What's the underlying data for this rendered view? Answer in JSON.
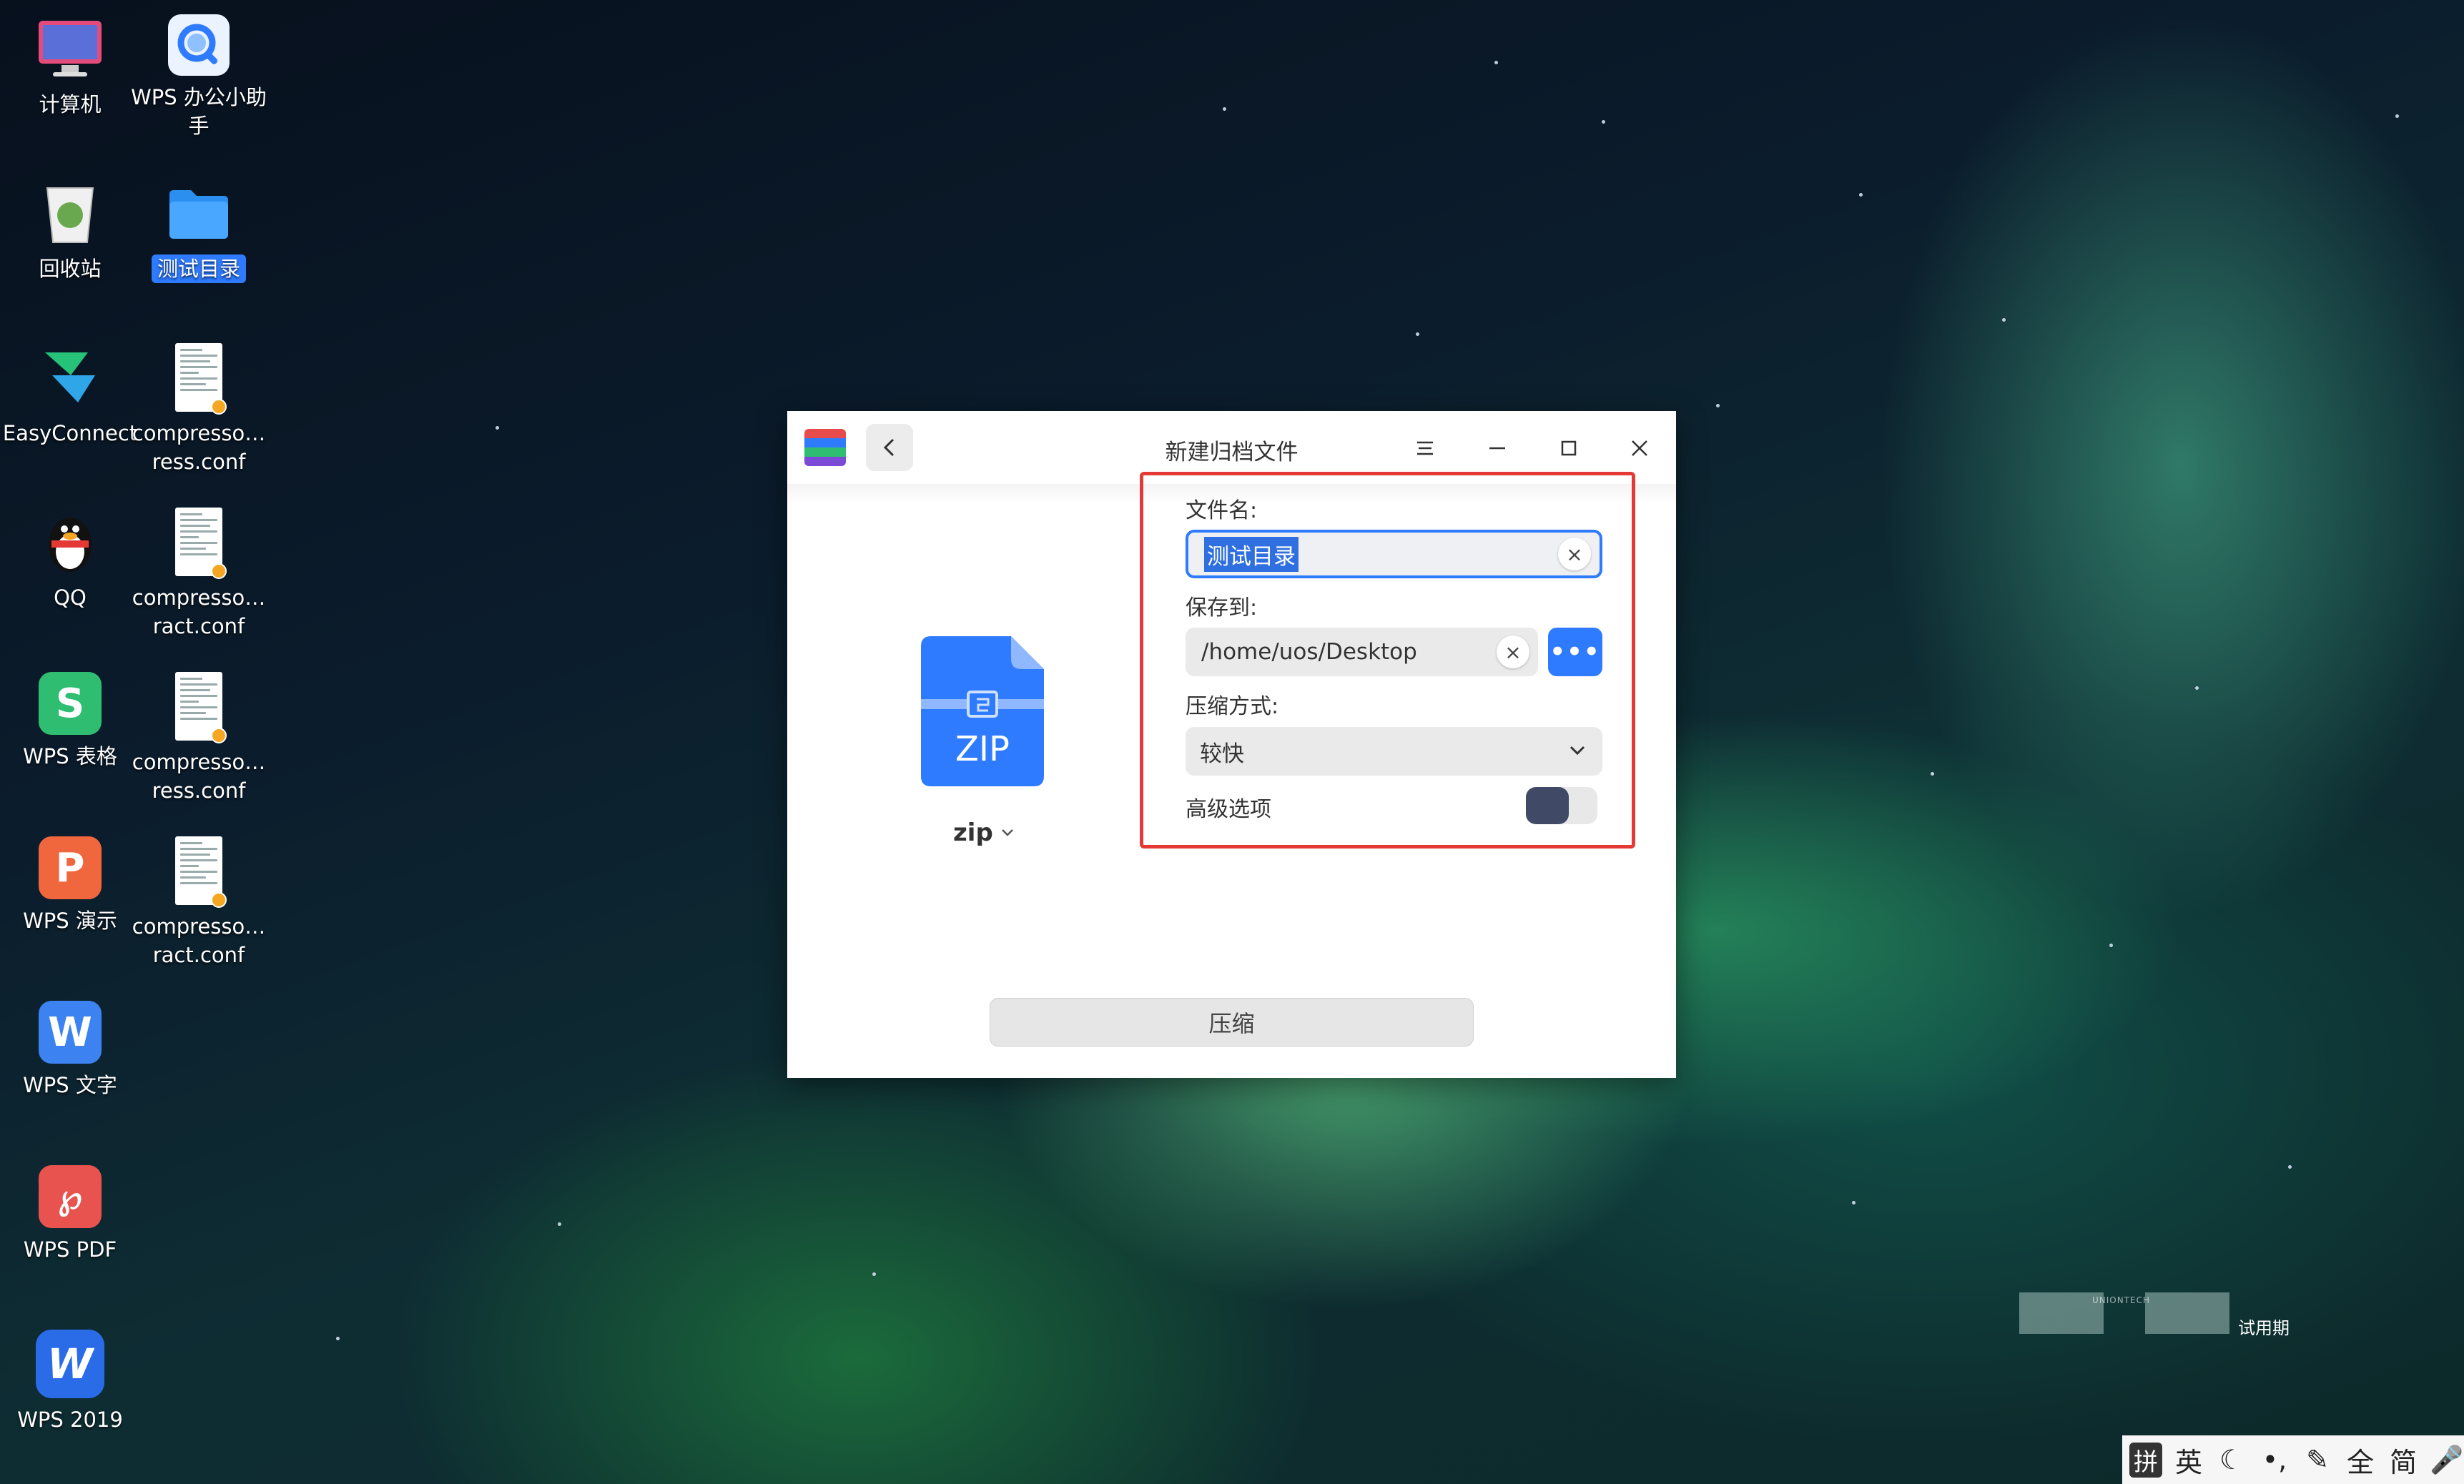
{
  "desktop": {
    "icons": [
      {
        "label": "计算机",
        "icon": "computer-icon"
      },
      {
        "label": "WPS 办公小助手",
        "icon": "wps-assistant-icon"
      },
      {
        "label": "回收站",
        "icon": "trash-icon"
      },
      {
        "label": "测试目录",
        "icon": "folder-icon"
      },
      {
        "label": "EasyConnect",
        "icon": "easyconnect-icon"
      },
      {
        "label": "compresso…ress.conf",
        "icon": "document-icon"
      },
      {
        "label": "QQ",
        "icon": "qq-icon"
      },
      {
        "label": "compresso…ract.conf",
        "icon": "document-icon"
      },
      {
        "label": "WPS 表格",
        "icon": "wps-sheet-icon"
      },
      {
        "label": "compresso…ress.conf",
        "icon": "document-icon"
      },
      {
        "label": "WPS 演示",
        "icon": "wps-presentation-icon"
      },
      {
        "label": "compresso…ract.conf",
        "icon": "document-icon"
      },
      {
        "label": "WPS 文字",
        "icon": "wps-writer-icon"
      },
      {
        "label": "WPS PDF",
        "icon": "wps-pdf-icon"
      },
      {
        "label": "WPS 2019",
        "icon": "wps-2019-icon"
      }
    ]
  },
  "dialog": {
    "title": "新建归档文件",
    "format_label": "zip",
    "zip_badge": "ZIP",
    "filename_label": "文件名:",
    "filename_value": "测试目录",
    "saveto_label": "保存到:",
    "saveto_value": "/home/uos/Desktop",
    "browse_label": "•••",
    "method_label": "压缩方式:",
    "method_value": "较快",
    "advanced_label": "高级选项",
    "advanced_enabled": false,
    "compress_button": "压缩",
    "clear_glyph": "×"
  },
  "watermark": {
    "brand": "UNIONTECH",
    "text": "试用期"
  },
  "ime": {
    "items": [
      "拼",
      "英",
      "☾",
      "•,",
      "✎",
      "全",
      "简",
      "🎤"
    ]
  },
  "colors": {
    "accent": "#2f7bff",
    "highlight_border": "#e53935",
    "toggle_knob": "#404a66"
  }
}
